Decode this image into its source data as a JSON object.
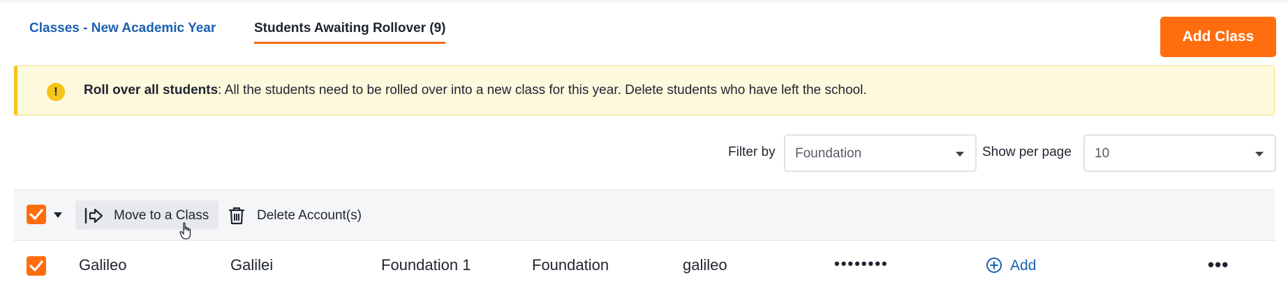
{
  "tabs": [
    {
      "label": "Classes - New Academic Year",
      "active": false
    },
    {
      "label": "Students Awaiting Rollover (9)",
      "active": true
    }
  ],
  "header": {
    "add_class_label": "Add Class"
  },
  "alert": {
    "icon": "exclamation-icon",
    "title": "Roll over all students",
    "message": ": All the students need to be rolled over into a new class for this year. Delete students who have left the school."
  },
  "filters": {
    "filter_by_label": "Filter by",
    "filter_by_value": "Foundation",
    "per_page_label": "Show per page",
    "per_page_value": "10"
  },
  "toolbar": {
    "select_all_checked": true,
    "move_label": "Move to a Class",
    "delete_label": "Delete Account(s)"
  },
  "students": [
    {
      "checked": true,
      "first_name": "Galileo",
      "last_name": "Galilei",
      "class": "Foundation 1",
      "year_level": "Foundation",
      "username": "galileo",
      "password": "••••••••",
      "add_label": "Add",
      "more": "•••"
    }
  ],
  "colors": {
    "accent": "#ff6d0f",
    "link": "#1a5fb0",
    "alert_bg": "#fdf9dd",
    "alert_border": "#f5c518"
  }
}
